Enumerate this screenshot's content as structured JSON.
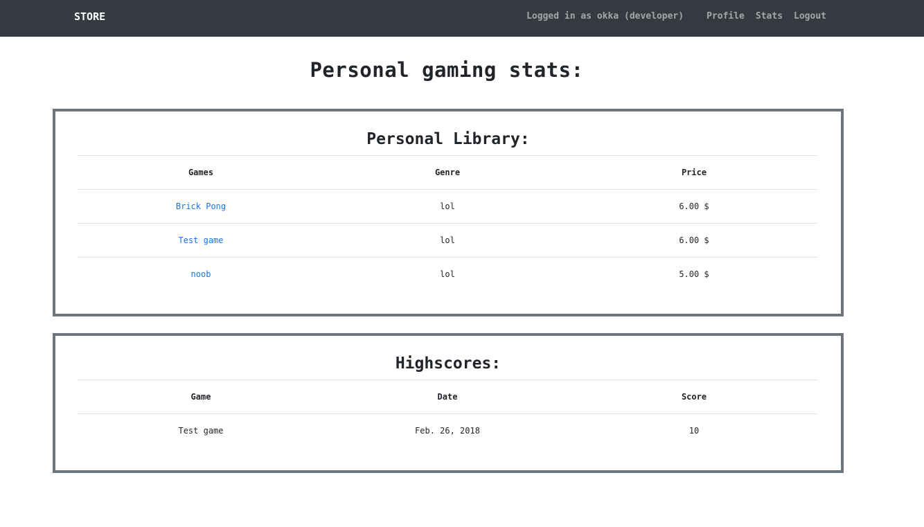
{
  "nav": {
    "brand": "STORE",
    "status": "Logged in as okka (developer)",
    "links": [
      "Profile",
      "Stats",
      "Logout"
    ]
  },
  "page": {
    "title": "Personal gaming stats:"
  },
  "library": {
    "title": "Personal Library:",
    "headers": [
      "Games",
      "Genre",
      "Price"
    ],
    "rows": [
      {
        "game": "Brick Pong",
        "genre": "lol",
        "price": "6.00 $"
      },
      {
        "game": "Test game",
        "genre": "lol",
        "price": "6.00 $"
      },
      {
        "game": "noob",
        "genre": "lol",
        "price": "5.00 $"
      }
    ]
  },
  "highscores": {
    "title": "Highscores:",
    "headers": [
      "Game",
      "Date",
      "Score"
    ],
    "rows": [
      {
        "game": "Test game",
        "date": "Feb. 26, 2018",
        "score": "10"
      }
    ]
  }
}
